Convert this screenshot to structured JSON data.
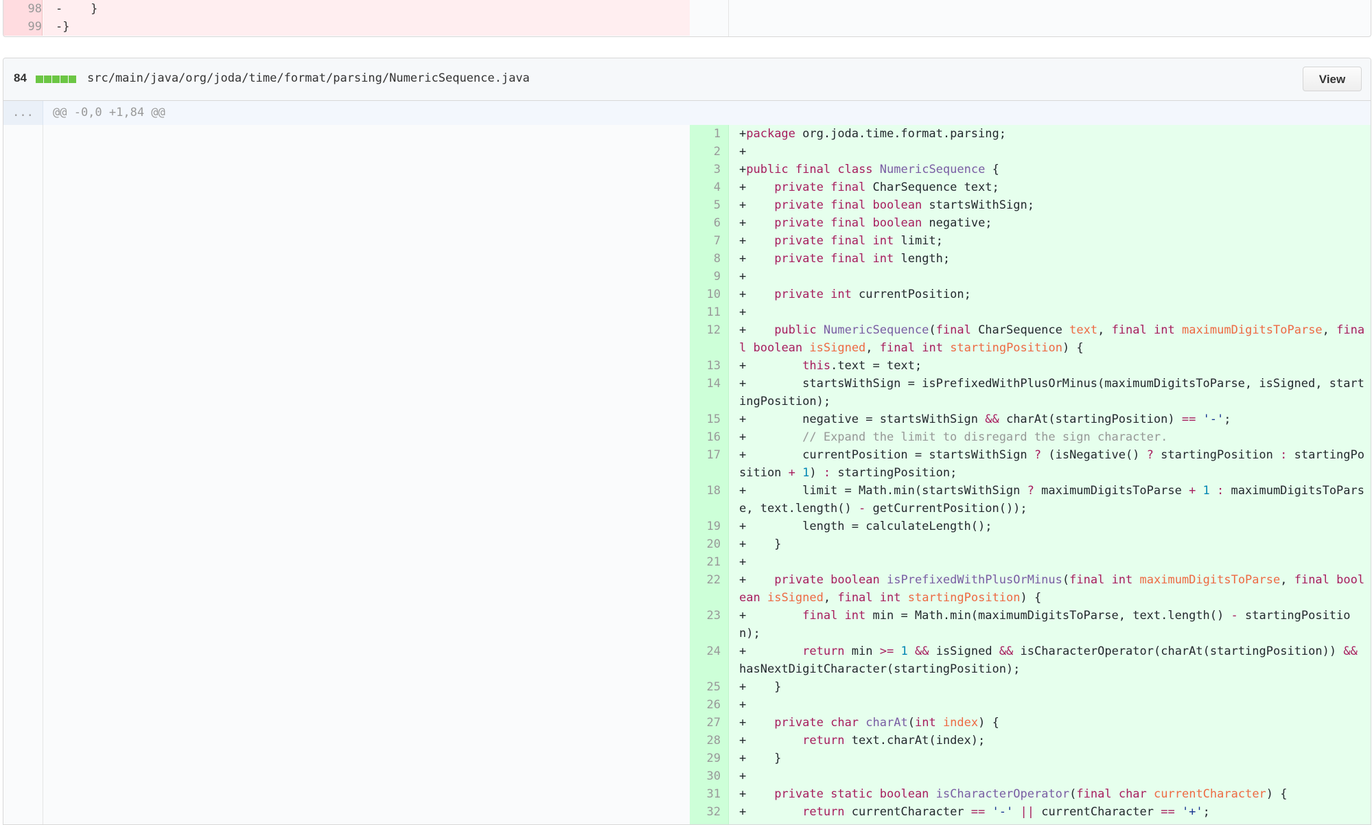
{
  "prev_file": {
    "lines": [
      {
        "num": "98",
        "text": "-    }"
      },
      {
        "num": "99",
        "text": "-}"
      }
    ]
  },
  "file": {
    "changes": "84",
    "path": "src/main/java/org/joda/time/format/parsing/NumericSequence.java",
    "view_label": "View",
    "expand_label": "...",
    "hunk_header": "@@ -0,0 +1,84 @@",
    "added_color": "#6cc644",
    "lines": [
      {
        "num": "1",
        "text": "+package org.joda.time.format.parsing;"
      },
      {
        "num": "2",
        "text": "+"
      },
      {
        "num": "3",
        "text": "+public final class NumericSequence {"
      },
      {
        "num": "4",
        "text": "+    private final CharSequence text;"
      },
      {
        "num": "5",
        "text": "+    private final boolean startsWithSign;"
      },
      {
        "num": "6",
        "text": "+    private final boolean negative;"
      },
      {
        "num": "7",
        "text": "+    private final int limit;"
      },
      {
        "num": "8",
        "text": "+    private final int length;"
      },
      {
        "num": "9",
        "text": "+"
      },
      {
        "num": "10",
        "text": "+    private int currentPosition;"
      },
      {
        "num": "11",
        "text": "+"
      },
      {
        "num": "12",
        "text": "+    public NumericSequence(final CharSequence text, final int maximumDigitsToParse, final boolean isSigned, final int startingPosition) {"
      },
      {
        "num": "13",
        "text": "+        this.text = text;"
      },
      {
        "num": "14",
        "text": "+        startsWithSign = isPrefixedWithPlusOrMinus(maximumDigitsToParse, isSigned, startingPosition);"
      },
      {
        "num": "15",
        "text": "+        negative = startsWithSign && charAt(startingPosition) == '-';"
      },
      {
        "num": "16",
        "text": "+        // Expand the limit to disregard the sign character."
      },
      {
        "num": "17",
        "text": "+        currentPosition = startsWithSign ? (isNegative() ? startingPosition : startingPosition + 1) : startingPosition;"
      },
      {
        "num": "18",
        "text": "+        limit = Math.min(startsWithSign ? maximumDigitsToParse + 1 : maximumDigitsToParse, text.length() - getCurrentPosition());"
      },
      {
        "num": "19",
        "text": "+        length = calculateLength();"
      },
      {
        "num": "20",
        "text": "+    }"
      },
      {
        "num": "21",
        "text": "+"
      },
      {
        "num": "22",
        "text": "+    private boolean isPrefixedWithPlusOrMinus(final int maximumDigitsToParse, final boolean isSigned, final int startingPosition) {"
      },
      {
        "num": "23",
        "text": "+        final int min = Math.min(maximumDigitsToParse, text.length() - startingPosition);"
      },
      {
        "num": "24",
        "text": "+        return min >= 1 && isSigned && isCharacterOperator(charAt(startingPosition)) && hasNextDigitCharacter(startingPosition);"
      },
      {
        "num": "25",
        "text": "+    }"
      },
      {
        "num": "26",
        "text": "+"
      },
      {
        "num": "27",
        "text": "+    private char charAt(int index) {"
      },
      {
        "num": "28",
        "text": "+        return text.charAt(index);"
      },
      {
        "num": "29",
        "text": "+    }"
      },
      {
        "num": "30",
        "text": "+"
      },
      {
        "num": "31",
        "text": "+    private static boolean isCharacterOperator(final char currentCharacter) {"
      },
      {
        "num": "32",
        "text": "+        return currentCharacter == '-' || currentCharacter == '+';"
      }
    ]
  }
}
